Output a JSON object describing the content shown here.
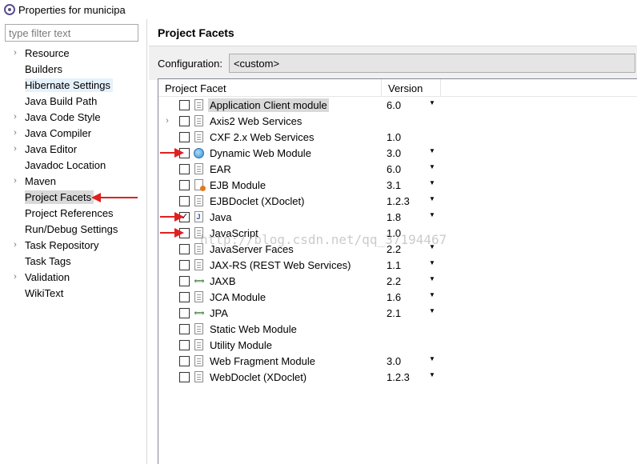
{
  "window": {
    "title": "Properties for municipa"
  },
  "sidebar": {
    "filter_placeholder": "type filter text",
    "items": [
      {
        "label": "Resource",
        "expandable": true
      },
      {
        "label": "Builders",
        "expandable": false
      },
      {
        "label": "Hibernate Settings",
        "expandable": false
      },
      {
        "label": "Java Build Path",
        "expandable": false
      },
      {
        "label": "Java Code Style",
        "expandable": true
      },
      {
        "label": "Java Compiler",
        "expandable": true
      },
      {
        "label": "Java Editor",
        "expandable": true
      },
      {
        "label": "Javadoc Location",
        "expandable": false
      },
      {
        "label": "Maven",
        "expandable": true
      },
      {
        "label": "Project Facets",
        "expandable": false,
        "selected": true
      },
      {
        "label": "Project References",
        "expandable": false
      },
      {
        "label": "Run/Debug Settings",
        "expandable": false
      },
      {
        "label": "Task Repository",
        "expandable": true
      },
      {
        "label": "Task Tags",
        "expandable": false
      },
      {
        "label": "Validation",
        "expandable": true
      },
      {
        "label": "WikiText",
        "expandable": false
      }
    ]
  },
  "main": {
    "heading": "Project Facets",
    "configuration_label": "Configuration:",
    "configuration_value": "<custom>",
    "columns": {
      "facet": "Project Facet",
      "version": "Version"
    },
    "facets": [
      {
        "name": "Application Client module",
        "version": "6.0",
        "checked": false,
        "icon": "doc-icon",
        "dropdown": true,
        "expandable": false,
        "highlight": true
      },
      {
        "name": "Axis2 Web Services",
        "version": "",
        "checked": false,
        "icon": "doc-icon",
        "dropdown": false,
        "expandable": true
      },
      {
        "name": "CXF 2.x Web Services",
        "version": "1.0",
        "checked": false,
        "icon": "doc-icon",
        "dropdown": false,
        "expandable": false
      },
      {
        "name": "Dynamic Web Module",
        "version": "3.0",
        "checked": false,
        "icon": "globe-icon",
        "dropdown": true,
        "expandable": false
      },
      {
        "name": "EAR",
        "version": "6.0",
        "checked": false,
        "icon": "doc-icon",
        "dropdown": true,
        "expandable": false
      },
      {
        "name": "EJB Module",
        "version": "3.1",
        "checked": false,
        "icon": "ejb-icon",
        "dropdown": true,
        "expandable": false
      },
      {
        "name": "EJBDoclet (XDoclet)",
        "version": "1.2.3",
        "checked": false,
        "icon": "doc-icon",
        "dropdown": true,
        "expandable": false
      },
      {
        "name": "Java",
        "version": "1.8",
        "checked": true,
        "icon": "java-icon",
        "dropdown": true,
        "expandable": false
      },
      {
        "name": "JavaScript",
        "version": "1.0",
        "checked": false,
        "icon": "doc-icon",
        "dropdown": false,
        "expandable": false
      },
      {
        "name": "JavaServer Faces",
        "version": "2.2",
        "checked": false,
        "icon": "doc-icon",
        "dropdown": true,
        "expandable": false
      },
      {
        "name": "JAX-RS (REST Web Services)",
        "version": "1.1",
        "checked": false,
        "icon": "doc-icon",
        "dropdown": true,
        "expandable": false
      },
      {
        "name": "JAXB",
        "version": "2.2",
        "checked": false,
        "icon": "arrows-icon",
        "dropdown": true,
        "expandable": false
      },
      {
        "name": "JCA Module",
        "version": "1.6",
        "checked": false,
        "icon": "doc-icon",
        "dropdown": true,
        "expandable": false
      },
      {
        "name": "JPA",
        "version": "2.1",
        "checked": false,
        "icon": "arrows-icon",
        "dropdown": true,
        "expandable": false
      },
      {
        "name": "Static Web Module",
        "version": "",
        "checked": false,
        "icon": "doc-icon",
        "dropdown": false,
        "expandable": false
      },
      {
        "name": "Utility Module",
        "version": "",
        "checked": false,
        "icon": "doc-icon",
        "dropdown": false,
        "expandable": false
      },
      {
        "name": "Web Fragment Module",
        "version": "3.0",
        "checked": false,
        "icon": "doc-icon",
        "dropdown": true,
        "expandable": false
      },
      {
        "name": "WebDoclet (XDoclet)",
        "version": "1.2.3",
        "checked": false,
        "icon": "doc-icon",
        "dropdown": true,
        "expandable": false
      }
    ]
  },
  "watermark": "http://blog.csdn.net/qq_37194467",
  "colors": {
    "annotation_arrow": "#e02020",
    "selection": "#d9d9d9",
    "hover_selection": "#e5f1fb"
  }
}
